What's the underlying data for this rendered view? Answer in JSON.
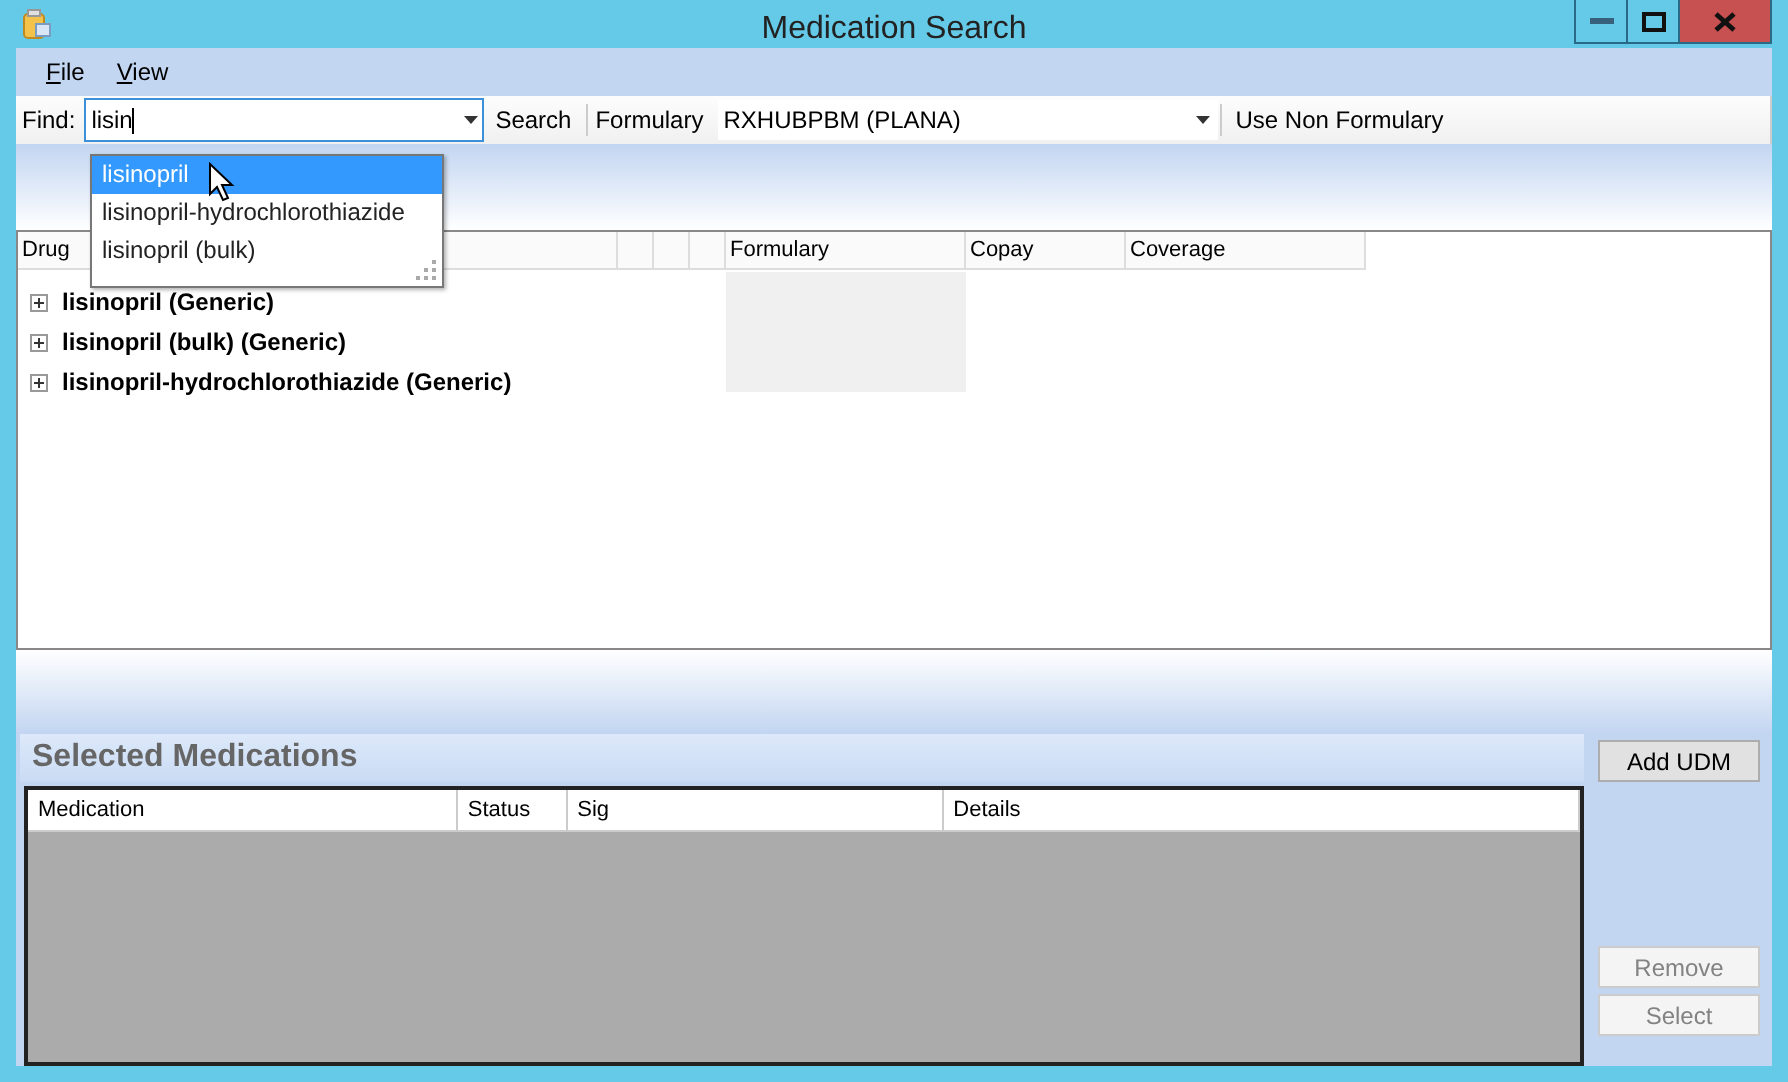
{
  "window": {
    "title": "Medication Search"
  },
  "menu": [
    {
      "label": "File"
    },
    {
      "label": "View"
    }
  ],
  "toolbar": {
    "find_label": "Find:",
    "find_value": "lisin",
    "search_button": "Search",
    "formulary_label": "Formulary",
    "formulary_value": "RXHUBPBM (PLANA)",
    "non_formulary_button": "Use Non Formulary"
  },
  "autocomplete": [
    {
      "label": "lisinopril",
      "selected": true
    },
    {
      "label": "lisinopril-hydrochlorothiazide",
      "selected": false
    },
    {
      "label": "lisinopril (bulk)",
      "selected": false
    }
  ],
  "drug_grid": {
    "columns": [
      "Drug",
      "",
      "",
      "",
      "Formulary",
      "Copay",
      "Coverage"
    ],
    "rows": [
      {
        "name": "lisinopril (Generic)",
        "expanded": false
      },
      {
        "name": "lisinopril (bulk) (Generic)",
        "expanded": false
      },
      {
        "name": "lisinopril-hydrochlorothiazide (Generic)",
        "expanded": false
      }
    ]
  },
  "selected_medications": {
    "title": "Selected Medications",
    "columns": [
      "Medication",
      "Status",
      "Sig",
      "Details"
    ]
  },
  "buttons": [
    {
      "label": "Add UDM",
      "disabled": false
    },
    {
      "label": "Remove",
      "disabled": true
    },
    {
      "label": "Select",
      "disabled": true
    }
  ]
}
